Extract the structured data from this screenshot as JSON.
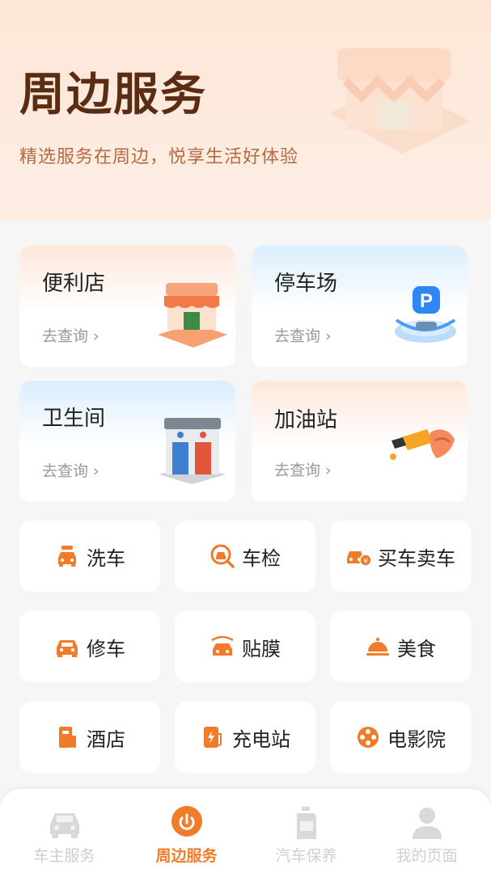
{
  "header": {
    "title": "周边服务",
    "subtitle": "精选服务在周边，悦享生活好体验"
  },
  "cards": [
    {
      "title": "便利店",
      "link": "去查询",
      "icon": "store-icon"
    },
    {
      "title": "停车场",
      "link": "去查询",
      "icon": "parking-icon"
    },
    {
      "title": "卫生间",
      "link": "去查询",
      "icon": "restroom-icon"
    },
    {
      "title": "加油站",
      "link": "去查询",
      "icon": "fuel-nozzle-icon"
    }
  ],
  "services": [
    {
      "label": "洗车",
      "icon": "car-wash-icon"
    },
    {
      "label": "车检",
      "icon": "car-inspection-icon"
    },
    {
      "label": "买车卖车",
      "icon": "car-trade-icon"
    },
    {
      "label": "修车",
      "icon": "car-repair-icon"
    },
    {
      "label": "贴膜",
      "icon": "car-film-icon"
    },
    {
      "label": "美食",
      "icon": "food-cloche-icon"
    },
    {
      "label": "酒店",
      "icon": "hotel-icon"
    },
    {
      "label": "充电站",
      "icon": "charging-station-icon"
    },
    {
      "label": "电影院",
      "icon": "film-reel-icon"
    }
  ],
  "tabbar": {
    "tabs": [
      {
        "label": "车主服务",
        "icon": "car-icon",
        "active": false
      },
      {
        "label": "周边服务",
        "icon": "location-icon",
        "active": true
      },
      {
        "label": "汽车保养",
        "icon": "oil-can-icon",
        "active": false
      },
      {
        "label": "我的页面",
        "icon": "user-icon",
        "active": false
      }
    ]
  },
  "colors": {
    "accent": "#f07c2a",
    "title_brown": "#5a2c12",
    "subtitle": "#b56a43",
    "inactive": "#cfcfcf"
  }
}
